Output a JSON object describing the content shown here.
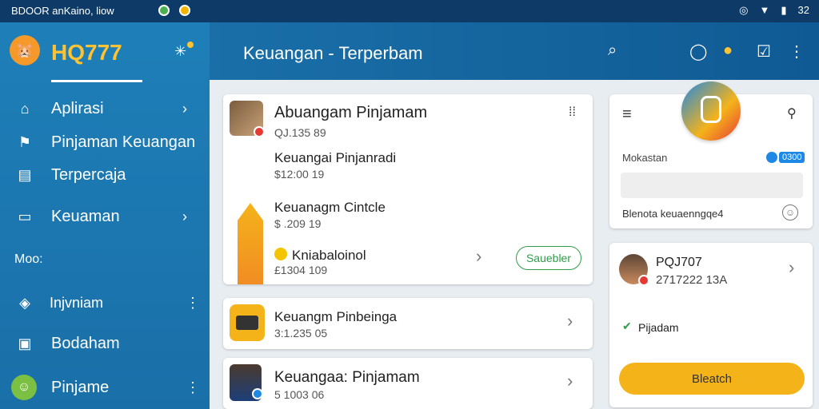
{
  "status_bar": {
    "left_text": "BDOOR anKaino, liow",
    "time": "32"
  },
  "sidebar": {
    "brand": "HQ777",
    "items": [
      {
        "label": "Aplirasi",
        "icon": "home-icon",
        "trail": "chevron"
      },
      {
        "label": "Pinjaman Keuangan",
        "icon": "flag-icon",
        "trail": ""
      },
      {
        "label": "Terpercaja",
        "icon": "document-icon",
        "trail": ""
      },
      {
        "label": "Keuaman",
        "icon": "wallet-icon",
        "trail": "chevron"
      }
    ],
    "section_label": "Moo:",
    "bottom_items": [
      {
        "label": "Injvniam",
        "icon": "tag-icon",
        "trail": "more"
      },
      {
        "label": "Bodaham",
        "icon": "clipboard-icon",
        "trail": ""
      },
      {
        "label": "Pinjame",
        "icon": "smiley-avatar-icon",
        "trail": "more"
      }
    ]
  },
  "header": {
    "title": "Keuangan - Terperbam"
  },
  "card_main": {
    "title": "Abuangam Pinjamam",
    "title_sub": "QJ.135   89",
    "row1_main": "Keuangai Pinjanradi",
    "row1_sub": "$12:00   19",
    "row2_main": "Keuanagm Cintcle",
    "row2_sub": "$  .209   19",
    "row3_main": "Kniabaloinol",
    "row3_sub": "£1304   109",
    "pill_label": "Sauebler"
  },
  "card_list": [
    {
      "main": "Keuangm Pinbeinga",
      "sub": "3:1.235   05"
    },
    {
      "main": "Keuangaa: Pinjamam",
      "sub": "5 1003   06"
    }
  ],
  "right_card_top": {
    "label1": "Mokastan",
    "badge": "0300",
    "label2": "Blenota keuaenngqe4"
  },
  "right_card_bottom": {
    "title": "PQJ707",
    "sub": "2717222  13A",
    "check_label": "Pijadam",
    "button_label": "Bleatch"
  },
  "colors": {
    "sidebar": "#1e7fb8",
    "header": "#0f5a94",
    "brand": "#ffc233",
    "accent_yellow": "#f5b31a",
    "accent_green": "#2e9e4a"
  }
}
